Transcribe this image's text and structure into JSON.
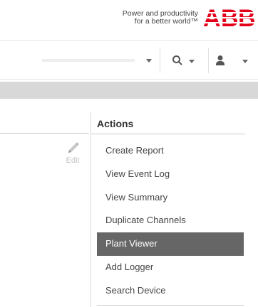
{
  "brand": {
    "tagline_line1": "Power and productivity",
    "tagline_line2": "for a better world™",
    "logo_text": "ABB",
    "logo_color": "#e2001a"
  },
  "toolbar": {
    "select_value": "",
    "search_icon": "search-icon",
    "user_icon": "user-icon"
  },
  "content": {
    "edit_label": "Edit",
    "edit_icon": "pencil-icon"
  },
  "actions": {
    "title": "Actions",
    "items": [
      {
        "label": "Create Report",
        "active": false
      },
      {
        "label": "View Event Log",
        "active": false
      },
      {
        "label": "View Summary",
        "active": false
      },
      {
        "label": "Duplicate Channels",
        "active": false
      },
      {
        "label": "Plant Viewer",
        "active": true
      },
      {
        "label": "Add Logger",
        "active": false
      },
      {
        "label": "Search Device",
        "active": false
      }
    ],
    "active_bg": "#666666"
  }
}
